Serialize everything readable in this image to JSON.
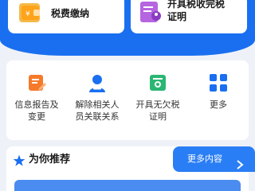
{
  "top_cards": {
    "left_label": "税费缴纳",
    "right_label_line1": "开具税收完税",
    "right_label_line2": "证明"
  },
  "services": [
    {
      "line1": "信息报告及",
      "line2": "变更",
      "icon": "report-edit-icon"
    },
    {
      "line1": "解除相关人",
      "line2": "员关联关系",
      "icon": "person-remove-icon"
    },
    {
      "line1": "开具无欠税",
      "line2": "证明",
      "icon": "certificate-icon"
    },
    {
      "line1": "更多",
      "line2": "",
      "icon": "grid-more-icon"
    }
  ],
  "recommend": {
    "title": "为你推荐",
    "more_label": "更多内容"
  },
  "colors": {
    "brand_blue": "#1a6ff0",
    "accent_orange": "#f57a2a",
    "accent_green": "#2bb673",
    "accent_purple": "#a64bd6"
  }
}
